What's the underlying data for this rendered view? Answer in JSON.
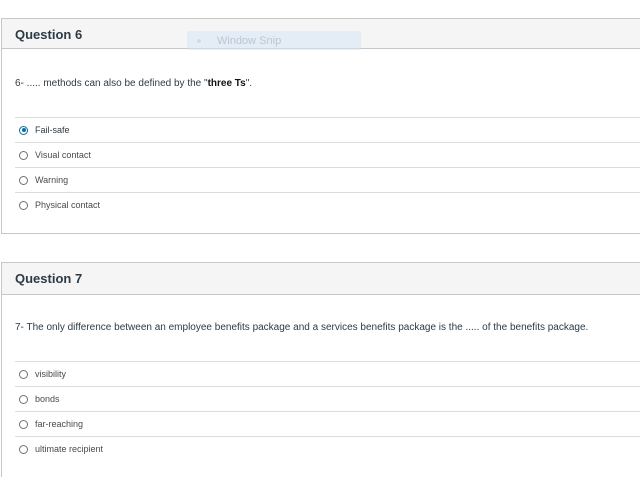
{
  "question6": {
    "title": "Question 6",
    "text_before": "6- ..... methods can also be defined by the \"",
    "text_bold": "three Ts",
    "text_after": "\".",
    "options": [
      {
        "label": "Fail-safe",
        "selected": true
      },
      {
        "label": "Visual contact",
        "selected": false
      },
      {
        "label": "Warning",
        "selected": false
      },
      {
        "label": "Physical contact",
        "selected": false
      }
    ]
  },
  "question7": {
    "title": "Question 7",
    "text": "7- The only difference between an employee benefits package and a services benefits package is the ..... of the benefits package.",
    "options": [
      {
        "label": "visibility",
        "selected": false
      },
      {
        "label": "bonds",
        "selected": false
      },
      {
        "label": "far-reaching",
        "selected": false
      },
      {
        "label": "ultimate recipient",
        "selected": false
      }
    ]
  },
  "overlay": {
    "label": "Window Snip"
  },
  "colors": {
    "accent": "#0770a3",
    "header_bg": "#f5f5f5",
    "border": "#c7c7c7"
  }
}
